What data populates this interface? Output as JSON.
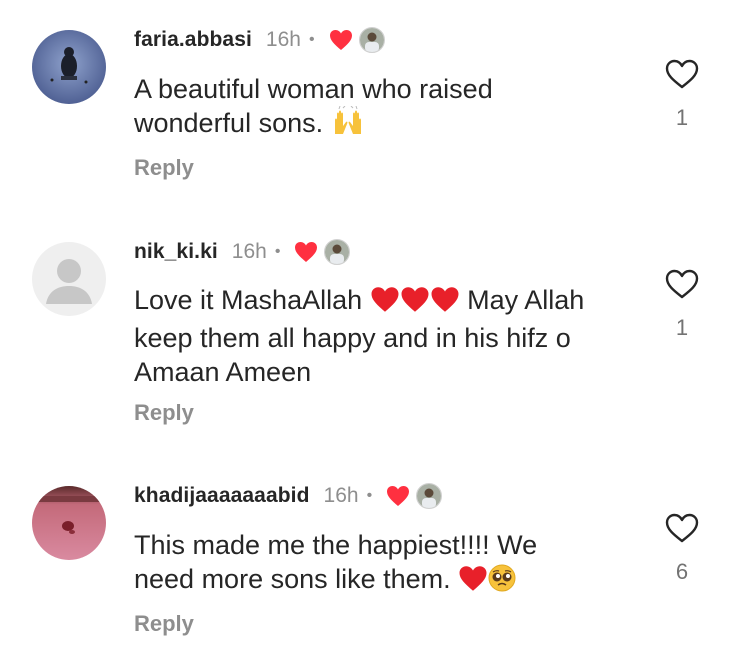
{
  "comments": [
    {
      "username": "faria.abbasi",
      "time": "16h",
      "dot": "•",
      "text_line1": "A beautiful woman who raised",
      "text_line2": "wonderful sons.",
      "text_line3": "",
      "reply": "Reply",
      "likes": "1",
      "avatar_icon": "profile-photo-silhouette",
      "emojis": [
        "raising-hands-icon"
      ]
    },
    {
      "username": "nik_ki.ki",
      "time": "16h",
      "dot": "•",
      "text_line1_a": "Love it MashaAllah",
      "text_line1_b": "May Allah",
      "text_line2": "keep them all happy and in his hifz o",
      "text_line3": "Amaan Ameen",
      "reply": "Reply",
      "likes": "1",
      "avatar_icon": "default-avatar",
      "emojis": [
        "red-heart-icon",
        "red-heart-icon",
        "red-heart-icon"
      ]
    },
    {
      "username": "khadijaaaaaaabid",
      "time": "16h",
      "dot": "•",
      "text_line1": "This made me the happiest!!!! We",
      "text_line2": "need more sons like them.",
      "reply": "Reply",
      "likes": "6",
      "avatar_icon": "profile-photo-pink",
      "emojis": [
        "red-heart-icon",
        "pleading-face-icon"
      ]
    }
  ],
  "colors": {
    "text": "#262626",
    "muted": "#8e8e8e",
    "heart": "#ff3040",
    "avatar_default_bg": "#dbdbdb",
    "avatar_default_fg": "#c7c7c7"
  }
}
